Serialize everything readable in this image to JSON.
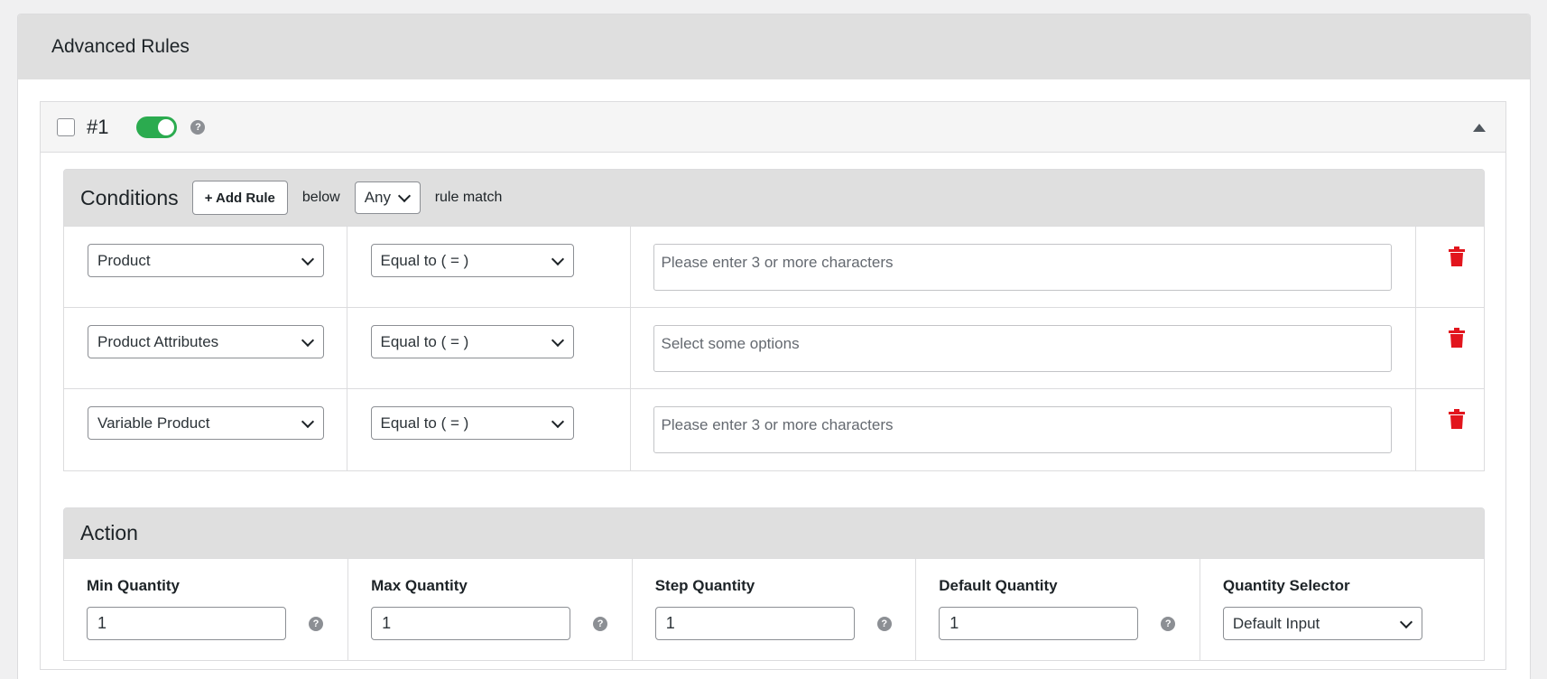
{
  "panel": {
    "title": "Advanced Rules"
  },
  "rule": {
    "number": "#1",
    "help": "?"
  },
  "conditions": {
    "title": "Conditions",
    "add_rule_label": "+ Add Rule",
    "below_label": "below",
    "match_value": "Any",
    "rule_match_label": "rule match",
    "rows": [
      {
        "field": "Product",
        "operator": "Equal to ( = )",
        "value_placeholder": "Please enter 3 or more characters"
      },
      {
        "field": "Product Attributes",
        "operator": "Equal to ( = )",
        "value_placeholder": "Select some options"
      },
      {
        "field": "Variable Product",
        "operator": "Equal to ( = )",
        "value_placeholder": "Please enter 3 or more characters"
      }
    ]
  },
  "action": {
    "title": "Action",
    "fields": [
      {
        "label": "Min Quantity",
        "value": "1"
      },
      {
        "label": "Max Quantity",
        "value": "1"
      },
      {
        "label": "Step Quantity",
        "value": "1"
      },
      {
        "label": "Default Quantity",
        "value": "1"
      }
    ],
    "selector": {
      "label": "Quantity Selector",
      "value": "Default Input"
    }
  },
  "colors": {
    "toggle_on": "#2bab4f",
    "trash": "#e2151d",
    "header_bg": "#dfdfdf"
  }
}
